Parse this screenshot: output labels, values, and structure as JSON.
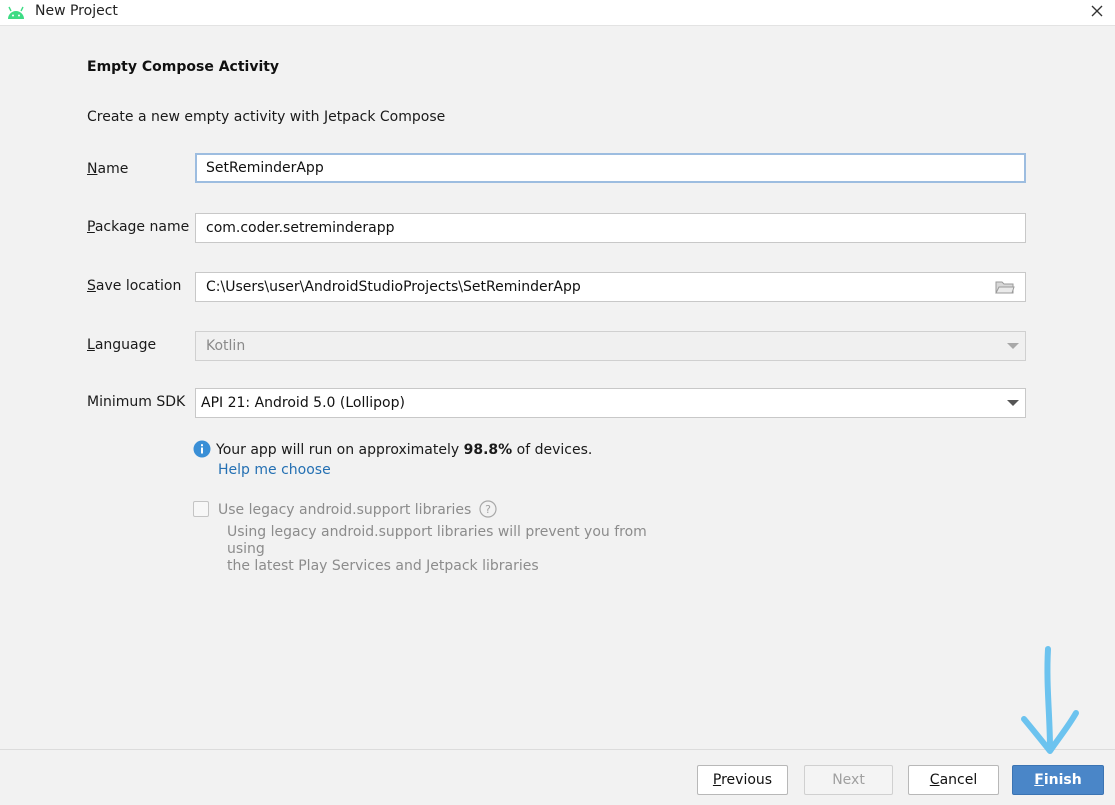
{
  "window": {
    "title": "New Project"
  },
  "page": {
    "heading": "Empty Compose Activity",
    "description": "Create a new empty activity with Jetpack Compose"
  },
  "form": {
    "name": {
      "label_mnemonic": "N",
      "label_rest": "ame",
      "value": "SetReminderApp"
    },
    "package": {
      "label_mnemonic": "P",
      "label_rest": "ackage name",
      "value": "com.coder.setreminderapp"
    },
    "save_location": {
      "label_mnemonic": "S",
      "label_rest": "ave location",
      "value": "C:\\Users\\user\\AndroidStudioProjects\\SetReminderApp"
    },
    "language": {
      "label_mnemonic": "L",
      "label_rest": "anguage",
      "value": "Kotlin"
    },
    "min_sdk": {
      "label": "Minimum SDK",
      "value": "API 21: Android 5.0 (Lollipop)"
    }
  },
  "info": {
    "text_before": "Your app will run on approximately ",
    "percent": "98.8%",
    "text_after": " of devices.",
    "help_link": "Help me choose"
  },
  "legacy": {
    "checkbox_label": "Use legacy android.support libraries",
    "checked": false,
    "description_line1": "Using legacy android.support libraries will prevent you from using",
    "description_line2": "the latest Play Services and Jetpack libraries"
  },
  "buttons": {
    "previous": {
      "mnemonic": "P",
      "rest": "revious"
    },
    "next": "Next",
    "cancel": {
      "mnemonic": "C",
      "rest": "ancel"
    },
    "finish": {
      "mnemonic": "F",
      "rest": "inish"
    }
  },
  "icons": {
    "app": "android-icon",
    "close": "close-icon",
    "folder": "folder-icon",
    "info": "info-icon",
    "help": "question-icon",
    "annotation": "arrow-down-annotation"
  },
  "colors": {
    "accent": "#4a86c8",
    "link": "#2470b3",
    "info_icon": "#3a8fd6",
    "android_green": "#3ddc84",
    "annotation": "#6cc3ef"
  }
}
